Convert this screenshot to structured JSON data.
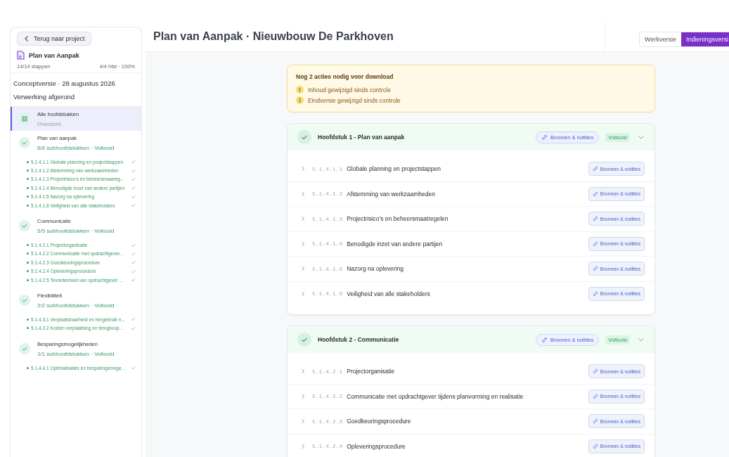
{
  "sidebar": {
    "back_button": "Terug naar project",
    "document": {
      "title": "Plan van Aanpak",
      "steps": "14/14 stappen",
      "progress": "4/4 hfst · 100%"
    },
    "version": "Conceptversie · 28 augustus 2026",
    "status": "Verwerking afgerond",
    "overview": {
      "title": "Alle hoofdstukken",
      "subtitle": "Overzicht",
      "selected": true
    },
    "chapters": [
      {
        "title": "Plan van aanpak",
        "summary": "6/6 subhoofdstukken · Voltooid",
        "selected": false,
        "items": [
          "5.1.4.1.1 Globale planning en projectstappen",
          "5.1.4.1.2 Afstemming van werkzaamheden",
          "5.1.4.1.3 Projectrisico's en beheersmaatreg...",
          "5.1.4.1.4 Benodigde inzet van andere partijen",
          "5.1.4.1.5 Nazorg na oplevering",
          "5.1.4.1.6 Veiligheid van alle stakeholders"
        ]
      },
      {
        "title": "Communicatie",
        "summary": "5/5 subhoofdstukken · Voltooid",
        "selected": false,
        "items": [
          "5.1.4.2.1 Projectorganisatie",
          "5.1.4.2.2 Communicatie met opdrachtgever...",
          "5.1.4.2.3 Goedkeuringsprocedure",
          "5.1.4.2.4 Opleveringsprocedure",
          "5.1.4.2.5 Tevredenheid van opdrachtgever ..."
        ]
      },
      {
        "title": "Flexibiliteit",
        "summary": "2/2 subhoofdstukken · Voltooid",
        "selected": false,
        "items": [
          "5.1.4.3.1 Verplaatsbaarheid en hergebruik n...",
          "5.1.4.3.2 Kosten verplaatsing en terugkoop..."
        ]
      },
      {
        "title": "Besparingsmogelijkheden",
        "summary": "1/1 subhoofdstukken · Voltooid",
        "selected": false,
        "items": [
          "5.1.4.4.1 Optimalisaties en besparingsmoge..."
        ]
      }
    ]
  },
  "header": {
    "title": "Plan van Aanpak · Nieuwbouw De Parkhoven"
  },
  "version_tabs": [
    {
      "label": "Werkversie",
      "selected": false
    },
    {
      "label": "Indieningsversi",
      "selected": true
    }
  ],
  "alert": {
    "title": "Nog 2 acties nodig voor download",
    "actions": [
      {
        "number": "1",
        "text": "Inhoud gewijzigd sinds controle"
      },
      {
        "number": "2",
        "text": "Eindversie gewijzigd sinds controle"
      }
    ]
  },
  "chapters": [
    {
      "title": "Hoofdstuk 1 - Plan van aanpak",
      "button": "Bronnen & notities",
      "badge": "Voltooid",
      "expanded": true,
      "rows": [
        {
          "number": "5.1.4.1.1",
          "title": "Globale planning en projectstappen",
          "button": "Bronnen & notities"
        },
        {
          "number": "5.1.4.1.2",
          "title": "Afstemming van werkzaamheden",
          "button": "Bronnen & notities"
        },
        {
          "number": "5.1.4.1.3",
          "title": "Projectrisico's en beheersmaatregelen",
          "button": "Bronnen & notities"
        },
        {
          "number": "5.1.4.1.4",
          "title": "Benodigde inzet van andere partijen",
          "button": "Bronnen & notities"
        },
        {
          "number": "5.1.4.1.5",
          "title": "Nazorg na oplevering",
          "button": "Bronnen & notities"
        },
        {
          "number": "5.1.4.1.6",
          "title": "Veiligheid van alle stakeholders",
          "button": "Bronnen & notities"
        }
      ]
    },
    {
      "title": "Hoofdstuk 2 - Communicatie",
      "button": "Bronnen & notities",
      "badge": "Voltooid",
      "expanded": true,
      "rows": [
        {
          "number": "5.1.4.2.1",
          "title": "Projectorganisatie",
          "button": "Bronnen & notities"
        },
        {
          "number": "5.1.4.2.2",
          "title": "Communicatie met opdrachtgever tijdens planvorming en realisatie",
          "button": "Bronnen & notities"
        },
        {
          "number": "5.1.4.2.3",
          "title": "Goedkeuringsprocedure",
          "button": "Bronnen & notities"
        },
        {
          "number": "5.1.4.2.4",
          "title": "Opleveringsprocedure",
          "button": "Bronnen & notities"
        }
      ]
    }
  ]
}
